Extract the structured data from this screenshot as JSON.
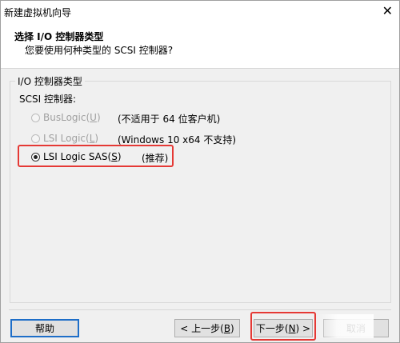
{
  "window": {
    "title": "新建虚拟机向导",
    "close_glyph": "✕"
  },
  "header": {
    "title": "选择 I/O 控制器类型",
    "subtitle": "您要使用何种类型的 SCSI 控制器?"
  },
  "group": {
    "legend": "I/O 控制器类型",
    "scsi_label": "SCSI 控制器:",
    "options": [
      {
        "label_pre": "BusLogic(",
        "mnemonic": "U",
        "label_post": ")",
        "note": "(不适用于 64 位客户机)",
        "state": "disabled"
      },
      {
        "label_pre": "LSI Logic(",
        "mnemonic": "L",
        "label_post": ")",
        "note": "(Windows 10 x64 不支持)",
        "state": "disabled"
      },
      {
        "label_pre": "LSI Logic SAS(",
        "mnemonic": "S",
        "label_post": ")",
        "note": "(推荐)",
        "state": "selected"
      }
    ]
  },
  "buttons": {
    "help": "帮助",
    "back_pre": "< 上一步(",
    "back_m": "B",
    "back_post": ")",
    "next_pre": "下一步(",
    "next_m": "N",
    "next_post": ") >",
    "cancel": "取消"
  },
  "colors": {
    "highlight": "#e53935",
    "focus": "#1e6ec8"
  }
}
